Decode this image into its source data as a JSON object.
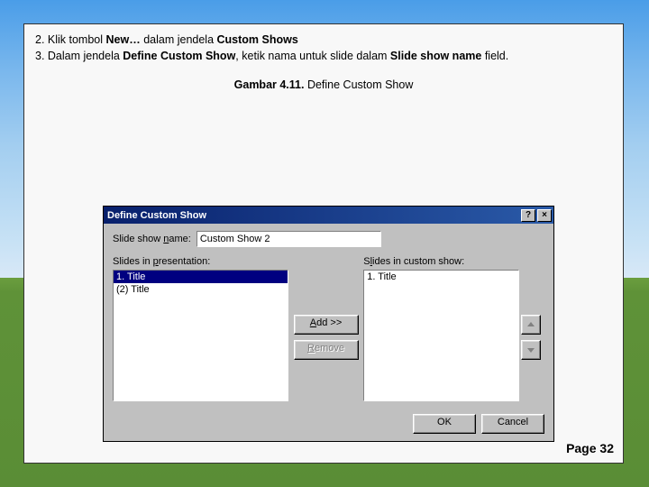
{
  "instructions": {
    "line2_prefix": "2. Klik tombol ",
    "line2_bold1": "New…",
    "line2_mid": " dalam jendela ",
    "line2_bold2": "Custom Shows",
    "line3_prefix": "3. Dalam jendela ",
    "line3_bold1": "Define Custom Show",
    "line3_mid": ", ketik nama untuk slide dalam ",
    "line3_bold2": "Slide show name",
    "line3_suffix": " field."
  },
  "caption_bold": "Gambar 4.11.",
  "caption_rest": " Define Custom Show",
  "page_number": "Page 32",
  "dialog": {
    "title": "Define Custom Show",
    "help_btn": "?",
    "close_btn": "×",
    "name_label_pre": "Slide show ",
    "name_label_u": "n",
    "name_label_post": "ame:",
    "name_value": "Custom Show 2",
    "left_label_pre": "Slides in ",
    "left_label_u": "p",
    "left_label_post": "resentation:",
    "right_label_pre": "S",
    "right_label_u": "l",
    "right_label_post": "ides in custom show:",
    "left_items": {
      "i0": "1. Title",
      "i1": "(2) Title"
    },
    "right_items": {
      "i0": "1. Title"
    },
    "add_pre": "",
    "add_u": "A",
    "add_post": "dd >>",
    "remove_pre": "",
    "remove_u": "R",
    "remove_post": "emove",
    "ok": "OK",
    "cancel": "Cancel"
  }
}
